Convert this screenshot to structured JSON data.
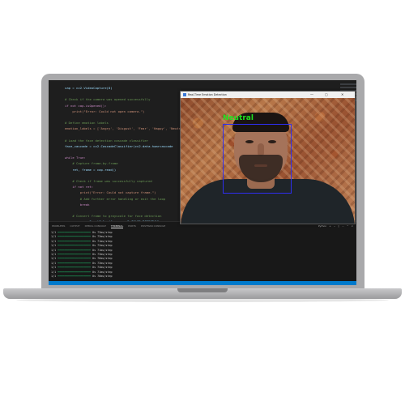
{
  "editor": {
    "line_numbers": [
      "",
      "",
      "",
      "",
      "",
      "",
      "",
      "",
      "",
      "",
      "",
      "",
      "",
      "",
      "",
      "",
      "",
      "",
      "",
      "",
      "",
      "",
      "",
      ""
    ],
    "lines": [
      {
        "text": "cap = cv2.VideoCapture(0)",
        "kind": "var"
      },
      {
        "text": "",
        "kind": ""
      },
      {
        "text": "# Check if the camera was opened successfully",
        "kind": "comment"
      },
      {
        "text": "if not cap.isOpened():",
        "kind": "kw"
      },
      {
        "text": "    print(\"Error: Could not open camera.\")",
        "kind": "str"
      },
      {
        "text": "",
        "kind": ""
      },
      {
        "text": "# Define emotion labels",
        "kind": "comment"
      },
      {
        "text": "emotion_labels = ['Angry', 'Disgust', 'Fear', 'Happy', 'Neutral'",
        "kind": "str"
      },
      {
        "text": "",
        "kind": ""
      },
      {
        "text": "# Load the face detection cascade classifier",
        "kind": "comment"
      },
      {
        "text": "face_cascade = cv2.CascadeClassifier(cv2.data.haarcascade",
        "kind": "var"
      },
      {
        "text": "",
        "kind": ""
      },
      {
        "text": "while True:",
        "kind": "kw"
      },
      {
        "text": "    # Capture frame-by-frame",
        "kind": "comment"
      },
      {
        "text": "    ret, frame = cap.read()",
        "kind": "var"
      },
      {
        "text": "",
        "kind": ""
      },
      {
        "text": "    # Check if frame was successfully captured",
        "kind": "comment"
      },
      {
        "text": "    if not ret:",
        "kind": "kw"
      },
      {
        "text": "        print(\"Error: Could not capture frame.\")",
        "kind": "str"
      },
      {
        "text": "        # Add further error handling or exit the loop",
        "kind": "comment"
      },
      {
        "text": "        break",
        "kind": "kw"
      },
      {
        "text": "",
        "kind": ""
      },
      {
        "text": "    # Convert frame to grayscale for face detection",
        "kind": "comment"
      },
      {
        "text": "    gray = cv2.cvtColor(frame, cv2.COLOR_BGR2GRAY)",
        "kind": "var"
      },
      {
        "text": "",
        "kind": ""
      },
      {
        "text": "    # Detect faces in the frame",
        "kind": "comment"
      },
      {
        "text": "    faces = face_cascade.detectMultiScale(gray, scaleFactor=",
        "kind": "var"
      }
    ]
  },
  "panel": {
    "tabs": [
      "PROBLEMS",
      "OUTPUT",
      "DEBUG CONSOLE",
      "TERMINAL",
      "PORTS",
      "POSTMAN CONSOLE"
    ],
    "active_tab": "TERMINAL",
    "actions": [
      "Python",
      "+",
      "⌄",
      "▯",
      "⋯",
      "^",
      "×"
    ],
    "terminal_lines": [
      {
        "prefix": "1/1 ",
        "bar": "━━━━━━━━━━━━━━━━━━━━",
        "suffix": " 0s 73ms/step"
      },
      {
        "prefix": "1/1 ",
        "bar": "━━━━━━━━━━━━━━━━━━━━",
        "suffix": " 0s 73ms/step"
      },
      {
        "prefix": "1/1 ",
        "bar": "━━━━━━━━━━━━━━━━━━━━",
        "suffix": " 0s 71ms/step"
      },
      {
        "prefix": "1/1 ",
        "bar": "━━━━━━━━━━━━━━━━━━━━",
        "suffix": " 0s 72ms/step"
      },
      {
        "prefix": "1/1 ",
        "bar": "━━━━━━━━━━━━━━━━━━━━",
        "suffix": " 0s 71ms/step"
      },
      {
        "prefix": "1/1 ",
        "bar": "━━━━━━━━━━━━━━━━━━━━",
        "suffix": " 0s 73ms/step"
      },
      {
        "prefix": "1/1 ",
        "bar": "━━━━━━━━━━━━━━━━━━━━",
        "suffix": " 0s 76ms/step"
      },
      {
        "prefix": "1/1 ",
        "bar": "━━━━━━━━━━━━━━━━━━━━",
        "suffix": " 0s 73ms/step"
      },
      {
        "prefix": "1/1 ",
        "bar": "━━━━━━━━━━━━━━━━━━━━",
        "suffix": " 0s 74ms/step"
      },
      {
        "prefix": "1/1 ",
        "bar": "━━━━━━━━━━━━━━━━━━━━",
        "suffix": " 0s 71ms/step"
      },
      {
        "prefix": "1/1 ",
        "bar": "━━━━━━━━━━━━━━━━━━━━",
        "suffix": " 0s 70ms/step"
      }
    ]
  },
  "camera_window": {
    "title": "Real-Time Emotion Detection",
    "controls": [
      "—",
      "▢",
      "✕"
    ],
    "emotion_label": "Neutral",
    "box_color": "#2e2ef0",
    "label_color": "#20e020"
  },
  "colors": {
    "accent": "#007acc",
    "terminal_bar": "#1fbf6a"
  }
}
